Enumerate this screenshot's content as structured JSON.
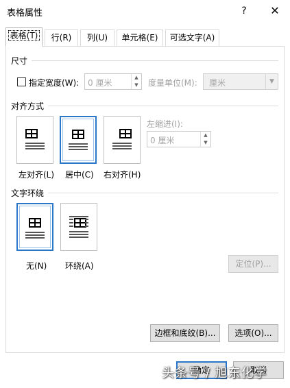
{
  "dialog": {
    "title": "表格属性",
    "help": "?",
    "close": "✕"
  },
  "tabs": [
    {
      "label": "表格(T)",
      "active": true
    },
    {
      "label": "行(R)"
    },
    {
      "label": "列(U)"
    },
    {
      "label": "单元格(E)"
    },
    {
      "label": "可选文字(A)"
    }
  ],
  "size": {
    "heading": "尺寸",
    "preferred_width_label": "指定宽度(W):",
    "preferred_width_value": "0 厘米",
    "measure_in_label": "度量单位(M):",
    "measure_in_value": "厘米"
  },
  "alignment": {
    "heading": "对齐方式",
    "options": [
      {
        "label": "左对齐(L)"
      },
      {
        "label": "居中(C)",
        "selected": true
      },
      {
        "label": "右对齐(H)"
      }
    ],
    "indent_label": "左缩进(I):",
    "indent_value": "0 厘米"
  },
  "wrapping": {
    "heading": "文字环绕",
    "options": [
      {
        "label": "无(N)",
        "selected": true
      },
      {
        "label": "环绕(A)"
      }
    ],
    "positioning_button": "定位(P)..."
  },
  "buttons": {
    "borders_shading": "边框和底纹(B)...",
    "options": "选项(O)...",
    "ok": "确定",
    "cancel": "取消"
  },
  "watermark": "头条号 / 旭东化学",
  "colors": {
    "accent": "#2a77c9"
  }
}
